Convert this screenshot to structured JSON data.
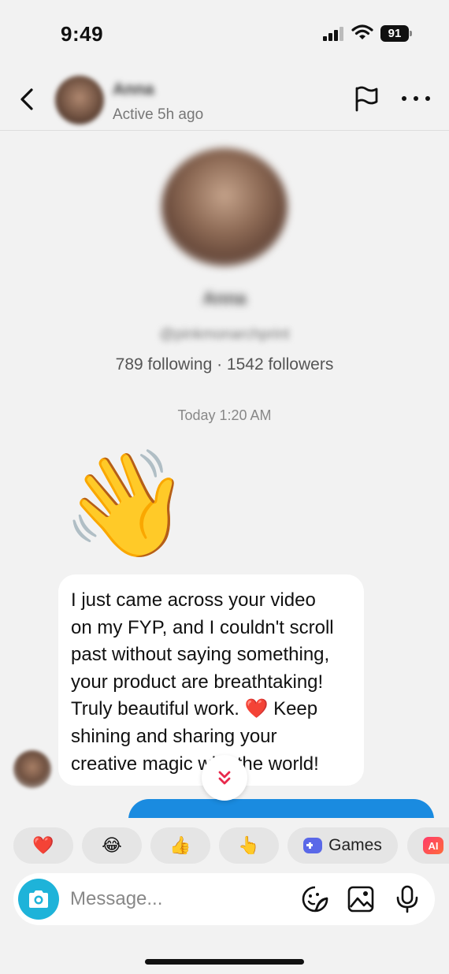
{
  "status_bar": {
    "time": "9:49",
    "battery": "91"
  },
  "header": {
    "name": "Anna",
    "status": "Active 5h ago"
  },
  "profile": {
    "name": "Anna",
    "handle": "@pinkmonarchprint",
    "stats": "789 following · 1542 followers"
  },
  "conversation": {
    "timestamp": "Today 1:20 AM",
    "wave_emoji": "👋",
    "message_lines": [
      "I just came across your video",
      "on my FYP, and I couldn't scroll",
      "past without saying something,",
      "your product are breathtaking!",
      "Truly beautiful work. ❤️ Keep",
      "shining and sharing your",
      "creative magic with the world!"
    ]
  },
  "quick_reactions": [
    {
      "emoji": "❤️"
    },
    {
      "emoji": "😂"
    },
    {
      "emoji": "👍"
    },
    {
      "emoji": "👆"
    }
  ],
  "games_chip": {
    "label": "Games",
    "icon": "gamepad-icon"
  },
  "ai_chip": {
    "label": "AI"
  },
  "composer": {
    "placeholder": "Message..."
  },
  "colors": {
    "accent_blue": "#1a8be0",
    "camera_teal": "#1eb3d9",
    "scroll_arrow": "#e8294c"
  }
}
